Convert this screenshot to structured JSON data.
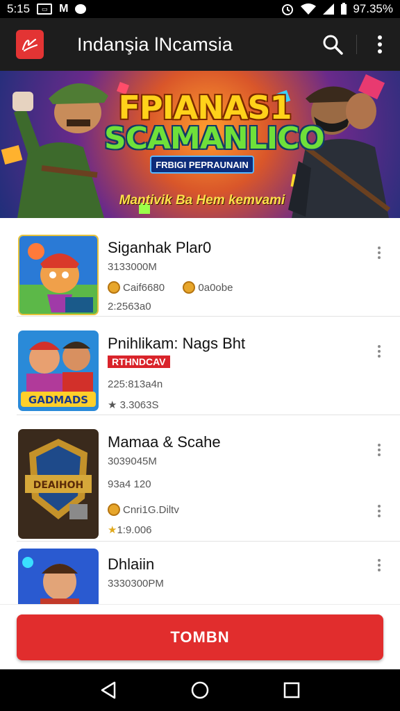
{
  "status_bar": {
    "time": "5:15",
    "battery": "97.35%",
    "icons": [
      "gallery-icon",
      "m-icon",
      "chat-bubble-icon",
      "alarm-icon",
      "wifi-icon",
      "signal-icon",
      "battery-icon"
    ]
  },
  "app_bar": {
    "title": "Indanşia lNcamsia",
    "logo_icon": "app-logo-icon",
    "search_icon": "search-icon",
    "more_icon": "more-vertical-icon"
  },
  "banner": {
    "title_line1": "FPIANAS1",
    "title_line2": "SCAMANLICO",
    "subtitle": "FRBIGI PEPRAUNAIN",
    "tagline": "Mantivik Ba Hem kemvami"
  },
  "list": {
    "items": [
      {
        "title": "Siganhak Plar0",
        "meta1": "3133000M",
        "coin1_text": "Caif6680",
        "coin2_text": "0a0obe",
        "meta3": "2:2563a0"
      },
      {
        "title": "Pnihlikam: Nags Bht",
        "badge": "RTHNDCAV",
        "meta2": "225:813a4n",
        "meta3": "★ 3.3063S"
      },
      {
        "title": "Mamaa & Scahe",
        "meta1": "3039045M",
        "meta2": "93a4 120",
        "coin_text": "Cnri1G.Diltv",
        "rating": "1:9.006"
      },
      {
        "title": "Dhlaiin",
        "meta1": "3330300PM"
      }
    ]
  },
  "bottom_button": {
    "label": "TOMBN"
  },
  "nav": {
    "back_icon": "back-icon",
    "home_icon": "home-icon",
    "recents_icon": "recents-icon"
  },
  "colors": {
    "accent": "#e12d2d",
    "app_bar": "#1d1d1d",
    "status_bar": "#000000"
  }
}
